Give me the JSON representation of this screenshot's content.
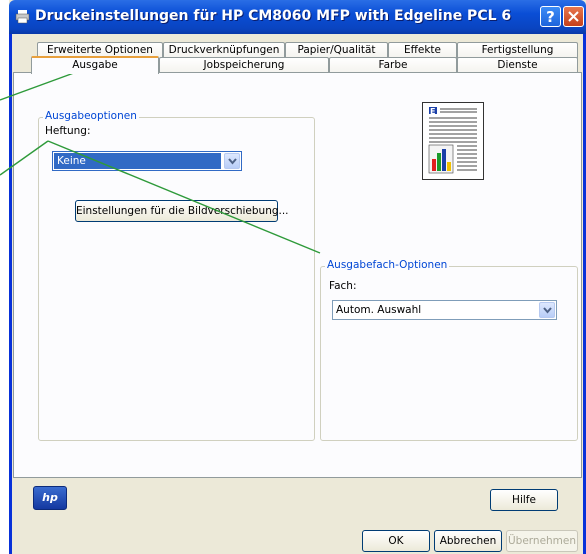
{
  "window": {
    "title": "Druckeinstellungen für HP CM8060 MFP with Edgeline PCL 6",
    "help_button": "?",
    "close_button": "X"
  },
  "tabs": {
    "row_back": [
      "Erweiterte Optionen",
      "Druckverknüpfungen",
      "Papier/Qualität",
      "Effekte",
      "Fertigstellung"
    ],
    "row_front": [
      "Ausgabe",
      "Jobspeicherung",
      "Farbe",
      "Dienste"
    ],
    "active": "Ausgabe"
  },
  "ausgabeoptionen": {
    "title": "Ausgabeoptionen",
    "heftung_label": "Heftung:",
    "heftung_value": "Keine",
    "bildverschiebung_button": "Einstellungen für die Bildverschiebung..."
  },
  "ausgabefach": {
    "title": "Ausgabefach-Optionen",
    "fach_label": "Fach:",
    "fach_value": "Autom. Auswahl"
  },
  "footer": {
    "logo_text": "hp",
    "hilfe_button": "Hilfe",
    "ok_button": "OK",
    "abbrechen_button": "Abbrechen",
    "uebernehmen_button": "Übernehmen"
  },
  "colors": {
    "titlebar": "#0a4ed6",
    "group_title": "#0046d5",
    "selection": "#316ac5",
    "callout_line": "#2e9a3a"
  },
  "icons": {
    "title_icon": "printer-icon",
    "dropdown": "chevron-down-icon",
    "preview": "page-preview-icon"
  }
}
